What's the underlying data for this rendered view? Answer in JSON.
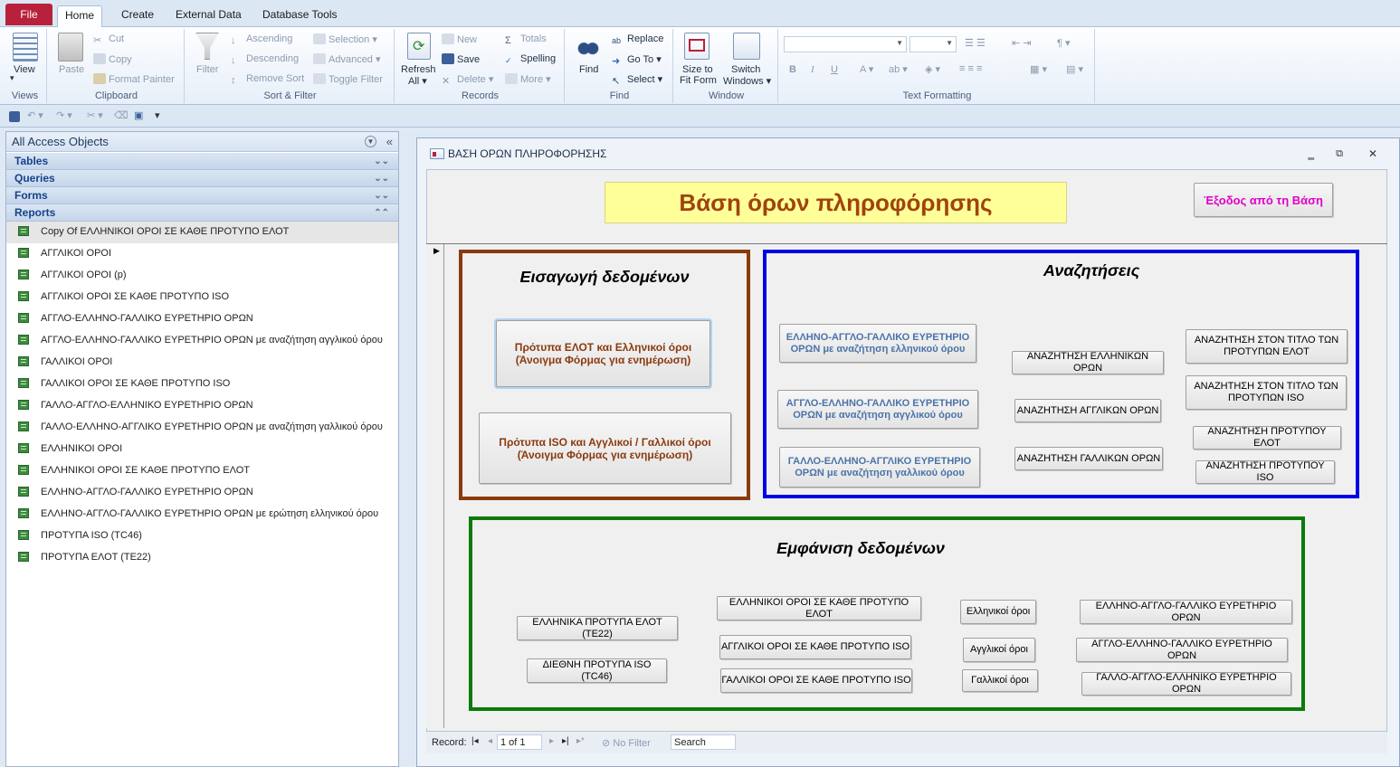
{
  "tabs": {
    "file": "File",
    "home": "Home",
    "create": "Create",
    "external": "External Data",
    "dbtools": "Database Tools"
  },
  "ribbon": {
    "views": {
      "view": "View",
      "group": "Views"
    },
    "clipboard": {
      "paste": "Paste",
      "cut": "Cut",
      "copy": "Copy",
      "format_painter": "Format Painter",
      "group": "Clipboard"
    },
    "sortfilter": {
      "filter": "Filter",
      "ascending": "Ascending",
      "descending": "Descending",
      "remove_sort": "Remove Sort",
      "selection": "Selection",
      "advanced": "Advanced",
      "toggle_filter": "Toggle Filter",
      "group": "Sort & Filter"
    },
    "records": {
      "refresh_all": "Refresh",
      "refresh_all2": "All",
      "new": "New",
      "save": "Save",
      "delete": "Delete",
      "totals": "Totals",
      "spelling": "Spelling",
      "more": "More",
      "group": "Records"
    },
    "find": {
      "find": "Find",
      "replace": "Replace",
      "goto": "Go To",
      "select": "Select",
      "group": "Find"
    },
    "window": {
      "size_fit": "Size to",
      "size_fit2": "Fit Form",
      "switch": "Switch",
      "switch2": "Windows",
      "group": "Window"
    },
    "textfmt": {
      "bold": "B",
      "italic": "I",
      "underline": "U",
      "group": "Text Formatting"
    }
  },
  "nav": {
    "header": "All Access Objects",
    "groups": {
      "tables": "Tables",
      "queries": "Queries",
      "forms": "Forms",
      "reports": "Reports"
    },
    "reports": [
      "Copy Of ΕΛΛΗΝΙΚΟΙ ΟΡΟΙ ΣΕ ΚΑΘΕ ΠΡΟΤΥΠΟ ΕΛΟΤ",
      "ΑΓΓΛΙΚΟΙ ΟΡΟΙ",
      "ΑΓΓΛΙΚΟΙ ΟΡΟΙ (p)",
      "ΑΓΓΛΙΚΟΙ ΟΡΟΙ ΣΕ ΚΑΘΕ ΠΡΟΤΥΠΟ ISO",
      "ΑΓΓΛΟ-ΕΛΛΗΝΟ-ΓΑΛΛΙΚΟ ΕΥΡΕΤΗΡΙΟ ΟΡΩΝ",
      "ΑΓΓΛΟ-ΕΛΛΗΝΟ-ΓΑΛΛΙΚΟ ΕΥΡΕΤΗΡΙΟ ΟΡΩΝ με αναζήτηση αγγλικού όρου",
      "ΓΑΛΛΙΚΟΙ ΟΡΟΙ",
      "ΓΑΛΛΙΚΟΙ ΟΡΟΙ ΣΕ ΚΑΘΕ ΠΡΟΤΥΠΟ ISO",
      "ΓΑΛΛΟ-ΑΓΓΛΟ-ΕΛΛΗΝΙΚΟ  ΕΥΡΕΤΗΡΙΟ ΟΡΩΝ",
      "ΓΑΛΛΟ-ΕΛΛΗΝΟ-ΑΓΓΛΙΚΟ ΕΥΡΕΤΗΡΙΟ ΟΡΩΝ με αναζήτηση γαλλικού όρου",
      "ΕΛΛΗΝΙΚΟΙ ΟΡΟΙ",
      "ΕΛΛΗΝΙΚΟΙ ΟΡΟΙ ΣΕ ΚΑΘΕ ΠΡΟΤΥΠΟ ΕΛΟΤ",
      "ΕΛΛΗΝΟ-ΑΓΓΛΟ-ΓΑΛΛΙΚΟ ΕΥΡΕΤΗΡΙΟ ΟΡΩΝ",
      "ΕΛΛΗΝΟ-ΑΓΓΛΟ-ΓΑΛΛΙΚΟ ΕΥΡΕΤΗΡΙΟ ΟΡΩΝ με ερώτηση ελληνικού όρου",
      "ΠΡΟΤΥΠΑ ISO (TC46)",
      "ΠΡΟΤΥΠΑ ΕΛΟΤ (ΤΕ22)"
    ]
  },
  "form": {
    "window_title": "ΒΑΣΗ ΟΡΩΝ ΠΛΗΡΟΦΟΡΗΣΗΣ",
    "title": "Βάση όρων πληροφόρησης",
    "exit": "Έξοδος από τη Βάση",
    "input": {
      "heading": "Εισαγωγή δεδομένων",
      "btn1": "Πρότυπα ΕΛΟΤ και Ελληνικοί όροι (Άνοιγμα Φόρμας για ενημέρωση)",
      "btn2": "Πρότυπα ISO  και Αγγλικοί / Γαλλικοί όροι (Άνοιγμα Φόρμας για ενημέρωση)"
    },
    "search": {
      "heading": "Αναζητήσεις",
      "gr_index": "ΕΛΛΗΝΟ-ΑΓΓΛΟ-ΓΑΛΛΙΚΟ ΕΥΡΕΤΗΡΙΟ ΟΡΩΝ με αναζήτηση ελληνικού όρου",
      "en_index": "ΑΓΓΛΟ-ΕΛΛΗΝΟ-ΓΑΛΛΙΚΟ ΕΥΡΕΤΗΡΙΟ ΟΡΩΝ με αναζήτηση αγγλικού όρου",
      "fr_index": "ΓΑΛΛΟ-ΕΛΛΗΝΟ-ΑΓΓΛΙΚΟ ΕΥΡΕΤΗΡΙΟ ΟΡΩΝ με αναζήτηση γαλλικού όρου",
      "gr_terms": "ΑΝΑΖΗΤΗΣΗ ΕΛΛΗΝΙΚΩΝ ΟΡΩΝ",
      "en_terms": "ΑΝΑΖΗΤΗΣΗ ΑΓΓΛΙΚΩΝ ΟΡΩΝ",
      "fr_terms": "ΑΝΑΖΗΤΗΣΗ ΓΑΛΛΙΚΩΝ ΟΡΩΝ",
      "title_elot": "ΑΝΑΖΗΤΗΣΗ ΣΤΟΝ ΤΙΤΛΟ ΤΩΝ ΠΡΟΤΥΠΩΝ ΕΛΟΤ",
      "title_iso": "ΑΝΑΖΗΤΗΣΗ ΣΤΟΝ ΤΙΤΛΟ ΤΩΝ ΠΡΟΤΥΠΩΝ ISO",
      "std_elot": "ΑΝΑΖΗΤΗΣΗ ΠΡΟΤΥΠΟΥ ΕΛΟΤ",
      "std_iso": "ΑΝΑΖΗΤΗΣΗ ΠΡΟΤΥΠΟΥ ISO"
    },
    "display": {
      "heading": "Εμφάνιση δεδομένων",
      "elot_std": "ΕΛΛΗΝΙΚΑ ΠΡΟΤΥΠΑ ΕΛΟΤ (ΤΕ22)",
      "iso_std": "ΔΙΕΘΝΗ ΠΡΟΤΥΠΑ ISO (TC46)",
      "gr_per_elot": "ΕΛΛΗΝΙΚΟΙ ΟΡΟΙ ΣΕ ΚΑΘΕ ΠΡΟΤΥΠΟ ΕΛΟΤ",
      "en_per_iso": "ΑΓΓΛΙΚΟΙ ΟΡΟΙ ΣΕ ΚΑΘΕ ΠΡΟΤΥΠΟ ISO",
      "fr_per_iso": "ΓΑΛΛΙΚΟΙ ΟΡΟΙ ΣΕ ΚΑΘΕ ΠΡΟΤΥΠΟ ISO",
      "gr_terms": "Ελληνικοί όροι",
      "en_terms": "Αγγλικοί  όροι",
      "fr_terms": "Γαλλικοί όροι",
      "gr_index": "ΕΛΛΗΝΟ-ΑΓΓΛΟ-ΓΑΛΛΙΚΟ ΕΥΡΕΤΗΡΙΟ ΟΡΩΝ",
      "en_index": "ΑΓΓΛΟ-ΕΛΛΗΝΟ-ΓΑΛΛΙΚΟ ΕΥΡΕΤΗΡΙΟ ΟΡΩΝ",
      "fr_index": "ΓΑΛΛΟ-ΑΓΓΛΟ-ΕΛΛΗΝΙΚΟ ΕΥΡΕΤΗΡΙΟ ΟΡΩΝ"
    },
    "recordnav": {
      "label": "Record:",
      "position": "1 of 1",
      "nofilter": "No Filter",
      "search": "Search"
    }
  },
  "colors": {
    "title_color": "#a0440e",
    "title_bg": "#ffff99",
    "exit_color": "#e000c8",
    "input_border": "#8b3a0e",
    "search_border": "#0000e6",
    "display_border": "#0a7a0a"
  }
}
